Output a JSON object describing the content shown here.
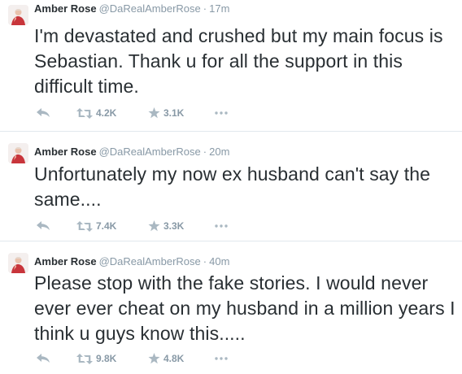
{
  "colors": {
    "name": "#292f33",
    "meta": "#8899a6",
    "icon": "#aab8c2",
    "divider": "#e1e8ed"
  },
  "icons": {
    "reply": "reply-icon",
    "retweet": "retweet-icon",
    "favorite": "star-icon",
    "more": "more-dots-icon"
  },
  "tweets": [
    {
      "name": "Amber Rose",
      "handle": "@DaRealAmberRose",
      "separator": "·",
      "time": "17m",
      "text": "I'm devastated and crushed but my main focus is Sebastian. Thank u for all the support in this difficult time.",
      "retweets": "4.2K",
      "favorites": "3.1K"
    },
    {
      "name": "Amber Rose",
      "handle": "@DaRealAmberRose",
      "separator": "·",
      "time": "20m",
      "text": "Unfortunately my now ex husband can't say the same....",
      "retweets": "7.4K",
      "favorites": "3.3K"
    },
    {
      "name": "Amber Rose",
      "handle": "@DaRealAmberRose",
      "separator": "·",
      "time": "40m",
      "text": "Please stop with the fake stories. I would never ever ever cheat on my husband in a million years I think u guys know this.....",
      "retweets": "9.8K",
      "favorites": "4.8K"
    }
  ]
}
